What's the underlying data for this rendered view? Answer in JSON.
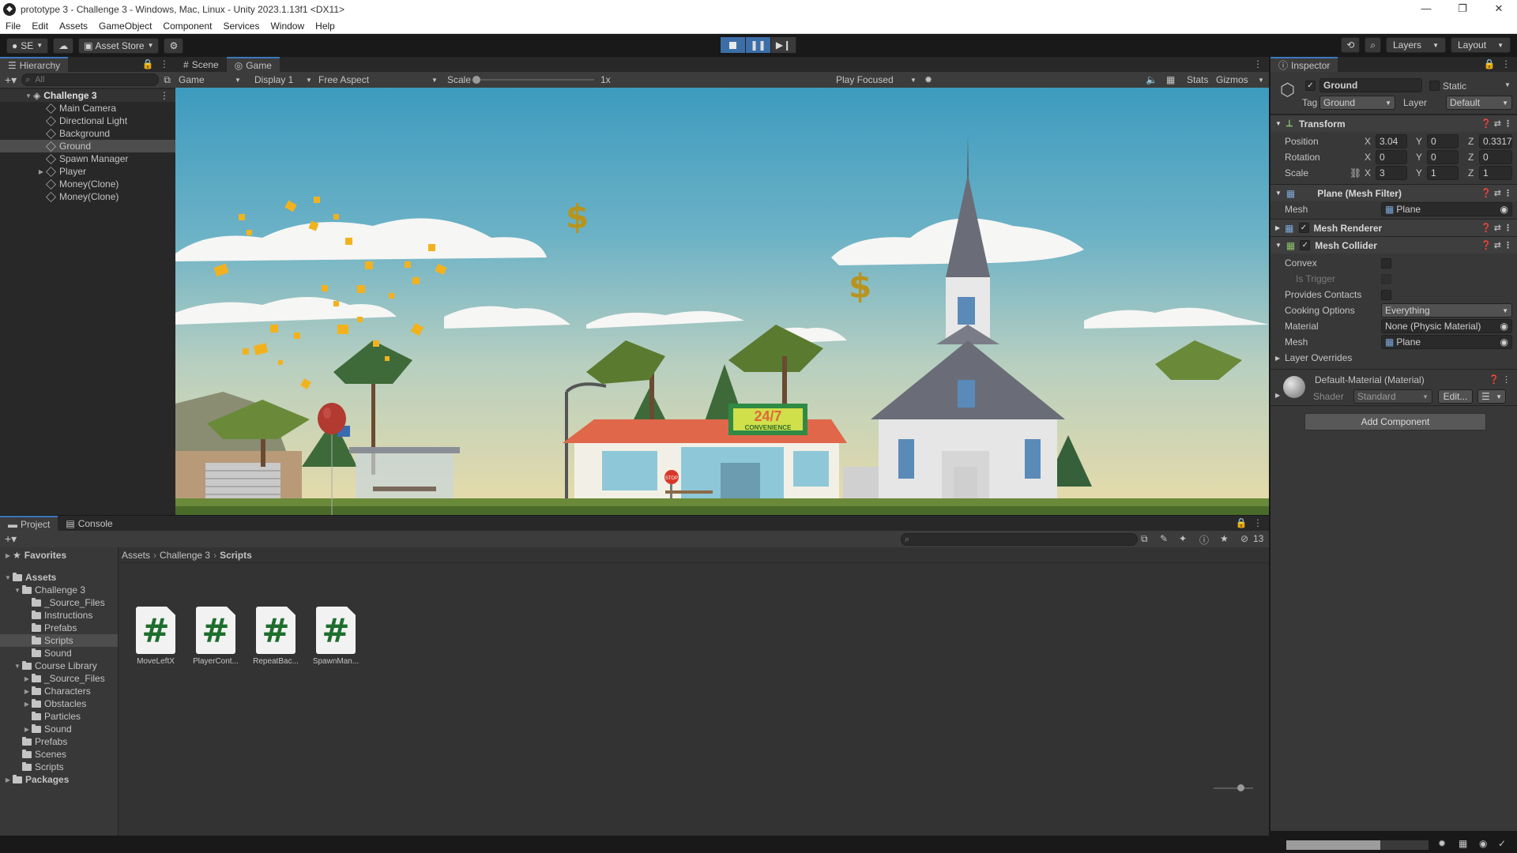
{
  "window": {
    "title": "prototype 3 - Challenge 3 - Windows, Mac, Linux - Unity 2023.1.13f1 <DX11>",
    "minimize": "—",
    "maximize": "❐",
    "close": "✕"
  },
  "menu": [
    "File",
    "Edit",
    "Assets",
    "GameObject",
    "Component",
    "Services",
    "Window",
    "Help"
  ],
  "toolbar": {
    "account": "SE",
    "asset_store": "Asset Store",
    "layers": "Layers",
    "layout": "Layout"
  },
  "hierarchy": {
    "tab": "Hierarchy",
    "search_placeholder": "All",
    "scene": "Challenge 3",
    "items": [
      "Main Camera",
      "Directional Light",
      "Background",
      "Ground",
      "Spawn Manager",
      "Player",
      "Money(Clone)",
      "Money(Clone)"
    ],
    "selected": "Ground"
  },
  "game": {
    "tab_scene": "Scene",
    "tab_game": "Game",
    "mode": "Game",
    "display": "Display 1",
    "aspect": "Free Aspect",
    "scale_label": "Scale",
    "scale_value": "1x",
    "play_focused": "Play Focused",
    "stats": "Stats",
    "gizmos": "Gizmos",
    "sign_top": "24/7",
    "sign_bottom": "CONVENIENCE",
    "stop_sign": "STOP"
  },
  "inspector": {
    "tab": "Inspector",
    "object_name": "Ground",
    "static_label": "Static",
    "tag_label": "Tag",
    "tag_value": "Ground",
    "layer_label": "Layer",
    "layer_value": "Default",
    "transform": {
      "title": "Transform",
      "position": {
        "label": "Position",
        "x": "3.04",
        "y": "0",
        "z": "0.3317"
      },
      "rotation": {
        "label": "Rotation",
        "x": "0",
        "y": "0",
        "z": "0"
      },
      "scale": {
        "label": "Scale",
        "x": "3",
        "y": "1",
        "z": "1"
      }
    },
    "mesh_filter": {
      "title": "Plane (Mesh Filter)",
      "mesh_label": "Mesh",
      "mesh_value": "Plane"
    },
    "mesh_renderer": {
      "title": "Mesh Renderer"
    },
    "mesh_collider": {
      "title": "Mesh Collider",
      "convex": "Convex",
      "is_trigger": "Is Trigger",
      "provides_contacts": "Provides Contacts",
      "cooking_label": "Cooking Options",
      "cooking_value": "Everything",
      "material_label": "Material",
      "material_value": "None (Physic Material)",
      "mesh_label": "Mesh",
      "mesh_value": "Plane"
    },
    "layer_overrides": "Layer Overrides",
    "material": {
      "name": "Default-Material (Material)",
      "shader_label": "Shader",
      "shader_value": "Standard",
      "edit": "Edit..."
    },
    "add_component": "Add Component"
  },
  "project": {
    "tab_project": "Project",
    "tab_console": "Console",
    "hidden_count": "13",
    "favorites": "Favorites",
    "tree": [
      {
        "label": "Assets",
        "depth": 0,
        "bold": true
      },
      {
        "label": "Challenge 3",
        "depth": 1
      },
      {
        "label": "_Source_Files",
        "depth": 2
      },
      {
        "label": "Instructions",
        "depth": 2
      },
      {
        "label": "Prefabs",
        "depth": 2
      },
      {
        "label": "Scripts",
        "depth": 2,
        "selected": true
      },
      {
        "label": "Sound",
        "depth": 2
      },
      {
        "label": "Course Library",
        "depth": 1
      },
      {
        "label": "_Source_Files",
        "depth": 2
      },
      {
        "label": "Characters",
        "depth": 2
      },
      {
        "label": "Obstacles",
        "depth": 2
      },
      {
        "label": "Particles",
        "depth": 2
      },
      {
        "label": "Sound",
        "depth": 2
      },
      {
        "label": "Prefabs",
        "depth": 1
      },
      {
        "label": "Scenes",
        "depth": 1
      },
      {
        "label": "Scripts",
        "depth": 1
      },
      {
        "label": "Packages",
        "depth": 0,
        "bold": true
      }
    ],
    "breadcrumb": [
      "Assets",
      "Challenge 3",
      "Scripts"
    ],
    "files": [
      "MoveLeftX",
      "PlayerCont...",
      "RepeatBac...",
      "SpawnMan..."
    ]
  },
  "status": {
    "progress": 0.66
  }
}
